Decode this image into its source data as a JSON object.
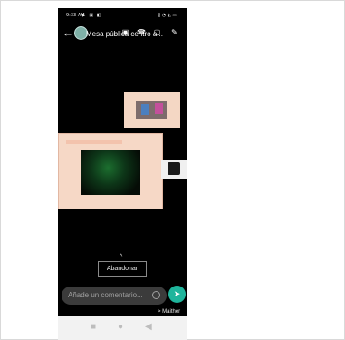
{
  "status": {
    "time": "9:33 AM",
    "left_icons": "▶ ▣ ◧ ⋯",
    "right_icons": "∦ ◔ ◭ ▭"
  },
  "header": {
    "title": "Mesa pública centro a..."
  },
  "meeting": {
    "caret": "^",
    "button_label": "Abandonar"
  },
  "composer": {
    "placeholder": "Añade un comentario..."
  },
  "footnote": "> Maither",
  "colors": {
    "send": "#1fb59c",
    "background": "#000000"
  },
  "icons": {
    "back": "back-arrow-icon",
    "group": "group-avatar-icon",
    "video": "video-call-icon",
    "call": "phone-call-icon",
    "gallery": "gallery-icon",
    "edit": "edit-icon",
    "clock": "clock-icon",
    "send": "send-icon"
  }
}
